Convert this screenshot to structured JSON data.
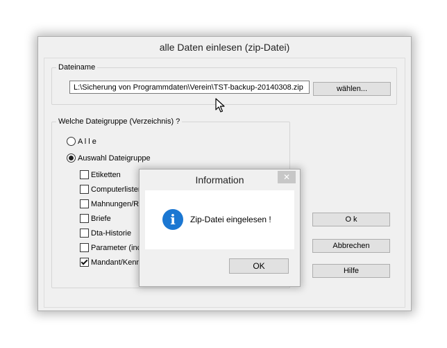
{
  "main_window": {
    "title": "alle Daten einlesen (zip-Datei)",
    "file_group": {
      "legend": "Dateiname",
      "path_value": "L:\\Sicherung von Programmdaten\\Verein\\TST-backup-20140308.zip",
      "choose_label": "wählen..."
    },
    "dir_group": {
      "legend": "Welche Dateigruppe (Verzeichnis) ?",
      "radios": [
        {
          "label": "A l l e",
          "selected": false
        },
        {
          "label": "Auswahl Dateigruppe",
          "selected": true
        }
      ],
      "checkboxes": [
        {
          "label": "Etiketten",
          "checked": false
        },
        {
          "label": "Computerlisten",
          "checked": false
        },
        {
          "label": "Mahnungen/Re",
          "checked": false
        },
        {
          "label": "Briefe",
          "checked": false
        },
        {
          "label": "Dta-Historie",
          "checked": false
        },
        {
          "label": "Parameter (inc",
          "checked": false
        },
        {
          "label": "Mandant/Kenn:",
          "checked": true
        }
      ]
    },
    "buttons": {
      "ok": "O k",
      "cancel": "Abbrechen",
      "help": "Hilfe"
    }
  },
  "info_dialog": {
    "title": "Information",
    "close_glyph": "✕",
    "icon_glyph": "i",
    "message": "Zip-Datei eingelesen !",
    "ok_label": "OK"
  },
  "colors": {
    "window_bg": "#f0f0f0",
    "info_icon": "#1b77d2",
    "close_button": "#c7c7c7"
  }
}
